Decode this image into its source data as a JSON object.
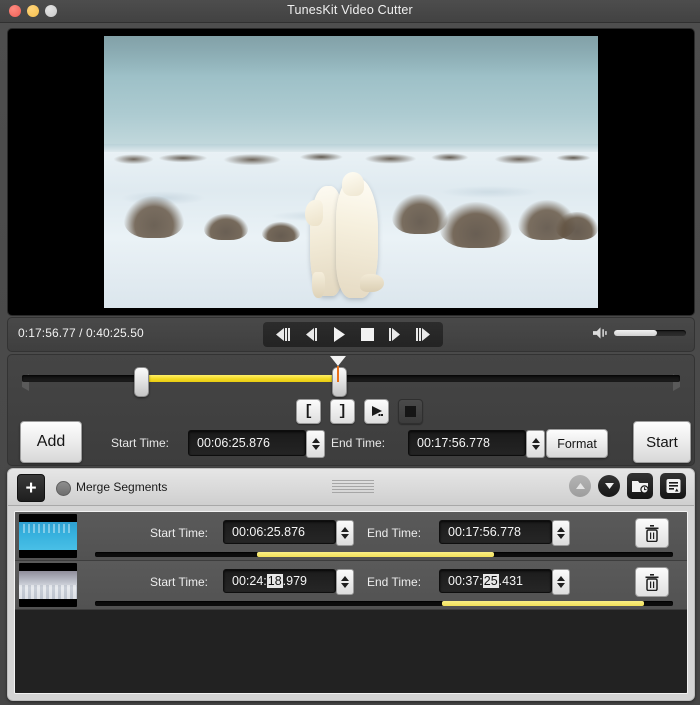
{
  "window": {
    "title": "TunesKit Video Cutter",
    "traffic_lights": [
      "close-button",
      "minimize-button",
      "zoom-button"
    ]
  },
  "player": {
    "current_time": "0:17:56.77",
    "separator": "/",
    "total_time": "0:40:25.50",
    "timecode": "0:17:56.77 / 0:40:25.50",
    "controls": [
      {
        "name": "prev-frame-fast-button",
        "icon": "skip-back-fast-icon"
      },
      {
        "name": "prev-frame-button",
        "icon": "step-back-icon"
      },
      {
        "name": "play-button",
        "icon": "play-icon"
      },
      {
        "name": "stop-button",
        "icon": "stop-icon"
      },
      {
        "name": "next-frame-button",
        "icon": "step-forward-icon"
      },
      {
        "name": "next-frame-fast-button",
        "icon": "skip-forward-fast-icon"
      }
    ],
    "volume": {
      "icon": "speaker-icon",
      "level_percent": 60
    }
  },
  "timeline": {
    "range_start_percent": 18,
    "range_end_percent": 48,
    "playhead_percent": 48,
    "handles": [
      "trim-start-handle",
      "trim-end-handle"
    ],
    "buttons": [
      {
        "name": "set-start-button",
        "glyph": "[",
        "enabled": true
      },
      {
        "name": "set-end-button",
        "glyph": "]",
        "enabled": true
      },
      {
        "name": "preview-clip-button",
        "glyph": "▶",
        "enabled": true
      },
      {
        "name": "stop-preview-button",
        "glyph": "■",
        "enabled": false
      }
    ]
  },
  "actions": {
    "add_label": "Add",
    "start_time_label": "Start Time:",
    "start_time_value": "00:06:25.876",
    "end_time_label": "End Time:",
    "end_time_value": "00:17:56.778",
    "format_label": "Format",
    "start_label": "Start"
  },
  "segments_panel": {
    "add_segment_glyph": "+",
    "merge_label": "Merge Segments",
    "merge_checked": false,
    "header_buttons": [
      {
        "name": "move-up-button",
        "icon": "chevron-up-icon",
        "enabled": false
      },
      {
        "name": "move-down-button",
        "icon": "chevron-down-icon",
        "enabled": true
      },
      {
        "name": "open-output-folder-button",
        "icon": "folder-clock-icon",
        "enabled": true
      },
      {
        "name": "segment-options-button",
        "icon": "list-settings-icon",
        "enabled": true
      }
    ],
    "rows": [
      {
        "thumbnail": "blue-water-thumbnail",
        "start_time_label": "Start Time:",
        "start_time_value": "00:06:25.876",
        "start_time_prefix": "00:06:25.876",
        "start_time_selected": "",
        "start_time_suffix": "",
        "end_time_label": "End Time:",
        "end_time_value": "00:17:56.778",
        "end_time_prefix": "00:17:56.778",
        "end_time_selected": "",
        "end_time_suffix": "",
        "bar_start_percent": 28,
        "bar_end_percent": 69,
        "delete_icon": "trash-icon"
      },
      {
        "thumbnail": "ice-sky-thumbnail",
        "start_time_label": "Start Time:",
        "start_time_value": "00:24:18.979",
        "start_time_prefix": "00:24:",
        "start_time_selected": "18",
        "start_time_suffix": ".979",
        "end_time_label": "End Time:",
        "end_time_value": "00:37:25.431",
        "end_time_prefix": "00:37:",
        "end_time_selected": "25",
        "end_time_suffix": ".431",
        "bar_start_percent": 60,
        "bar_end_percent": 95,
        "delete_icon": "trash-icon"
      }
    ]
  }
}
